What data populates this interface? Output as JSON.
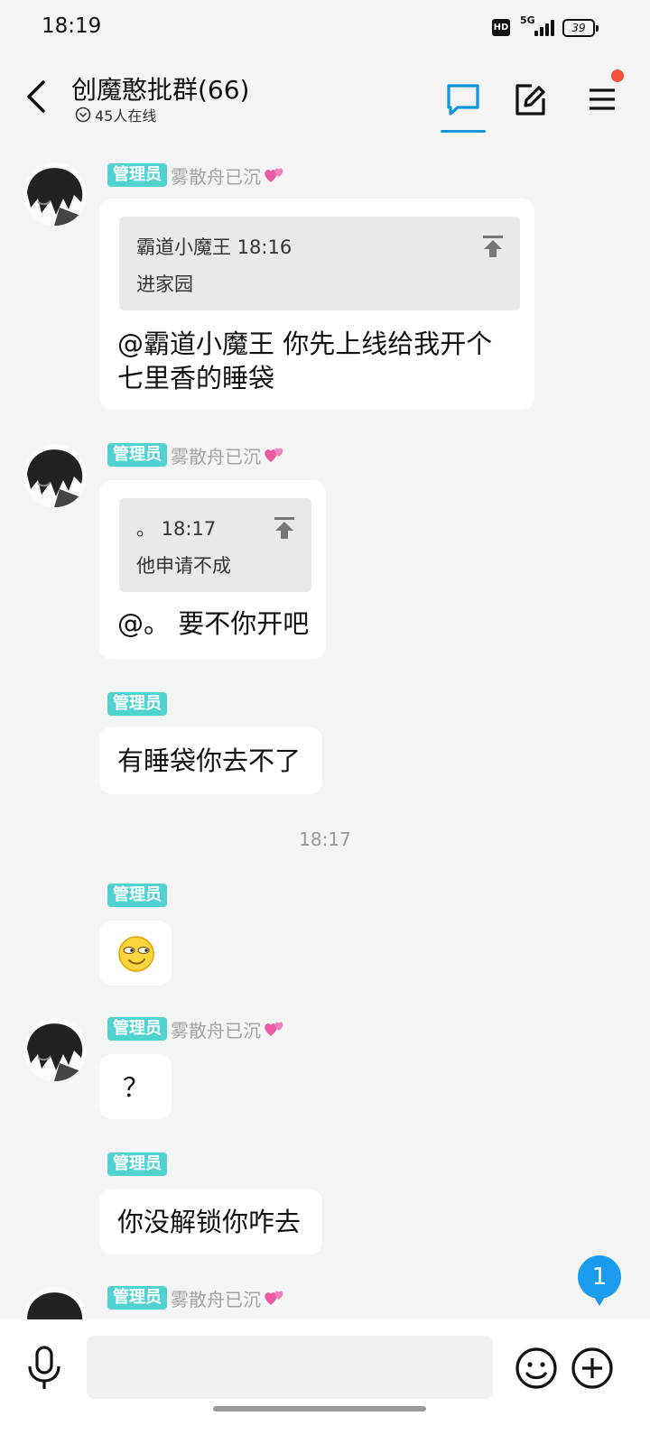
{
  "status_bar": {
    "time": "18:19",
    "hd": "HD",
    "network": "5G",
    "battery": "39"
  },
  "header": {
    "title": "创魔憨批群(66)",
    "online": "45人在线",
    "icons": [
      "back-arrow-icon",
      "chat-bubble-icon",
      "edit-icon",
      "menu-icon"
    ],
    "accent_color": "#1296db",
    "notification_dot_color": "#f4503a"
  },
  "messages": [
    {
      "role": "管理员",
      "nickname": "雾散舟已沉",
      "nickname_icon": "two-hearts-icon",
      "quote": {
        "head": "霸道小魔王 18:16",
        "body": "进家园"
      },
      "text_lines": [
        "@霸道小魔王 你先上线给我开个",
        "七里香的睡袋"
      ]
    },
    {
      "role": "管理员",
      "nickname": "雾散舟已沉",
      "nickname_icon": "two-hearts-icon",
      "quote": {
        "head": "。 18:17",
        "body": "他申请不成"
      },
      "text": "@。 要不你开吧"
    },
    {
      "role": "管理员",
      "text": "有睡袋你去不了"
    },
    {
      "time_separator": "18:17"
    },
    {
      "role": "管理员",
      "emoji": "smirk-emoji-icon"
    },
    {
      "role": "管理员",
      "nickname": "雾散舟已沉",
      "nickname_icon": "two-hearts-icon",
      "text": "？"
    },
    {
      "role": "管理员",
      "text": "你没解锁你咋去"
    },
    {
      "role": "管理员",
      "nickname": "雾散舟已沉",
      "nickname_icon": "two-hearts-icon"
    }
  ],
  "badge_color": "#4fd2d0",
  "unread_count": "1",
  "input_bar": {
    "placeholder": "",
    "icons": [
      "microphone-icon",
      "emoji-icon",
      "plus-icon"
    ]
  }
}
